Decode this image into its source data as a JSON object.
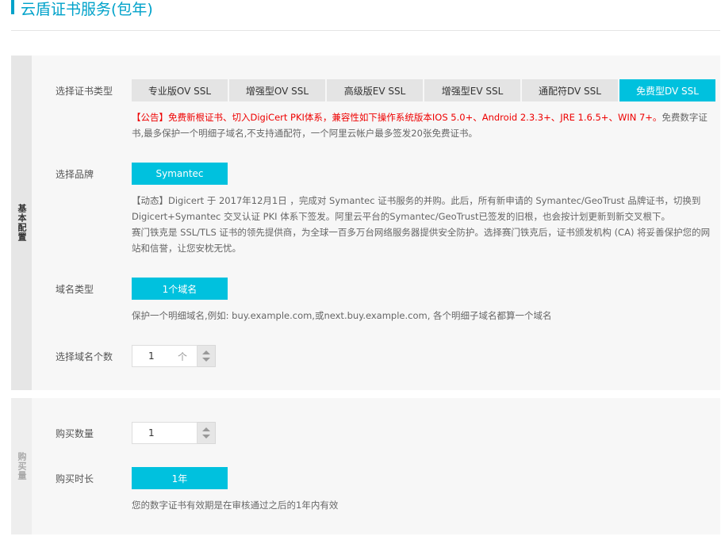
{
  "page": {
    "title": "云盾证书服务(包年)"
  },
  "basic": {
    "side_label": "基本配置",
    "cert_type": {
      "label": "选择证书类型",
      "tabs": [
        "专业版OV SSL",
        "增强型OV SSL",
        "高级版EV SSL",
        "增强型EV SSL",
        "通配符DV SSL",
        "免费型DV SSL"
      ],
      "active_index": 5,
      "notice_red": "【公告】免费新根证书、切入DigiCert PKI体系，兼容性如下操作系统版本IOS 5.0+、Android 2.3.3+、JRE 1.6.5+、WIN 7+。",
      "notice_gray": "免费数字证书,最多保护一个明细子域名,不支持通配符，一个阿里云帐户最多签发20张免费证书。"
    },
    "brand": {
      "label": "选择品牌",
      "selected": "Symantec",
      "note_p1": "【动态】Digicert 于 2017年12月1日 ，完成对 Symantec 证书服务的并购。此后，所有新申请的 Symantec/GeoTrust 品牌证书，切换到 Digicert+Symantec 交叉认证 PKI 体系下签发。阿里云平台的Symantec/GeoTrust已签发的旧根，也会按计划更新到新交叉根下。",
      "note_p2": "赛门铁克是 SSL/TLS 证书的领先提供商，为全球一百多万台网络服务器提供安全防护。选择赛门铁克后，证书颁发机构 (CA) 将妥善保护您的网站和信誉，让您安枕无忧。"
    },
    "domain_type": {
      "label": "域名类型",
      "selected": "1个域名",
      "note": "保护一个明细域名,例如: buy.example.com,或next.buy.example.com, 各个明细子域名都算一个域名"
    },
    "domain_count": {
      "label": "选择域名个数",
      "value": "1",
      "unit": "个"
    }
  },
  "purchase": {
    "side_label": "购买量",
    "quantity": {
      "label": "购买数量",
      "value": "1"
    },
    "duration": {
      "label": "购买时长",
      "selected": "1年",
      "note": "您的数字证书有效期是在审核通过之后的1年内有效"
    }
  }
}
